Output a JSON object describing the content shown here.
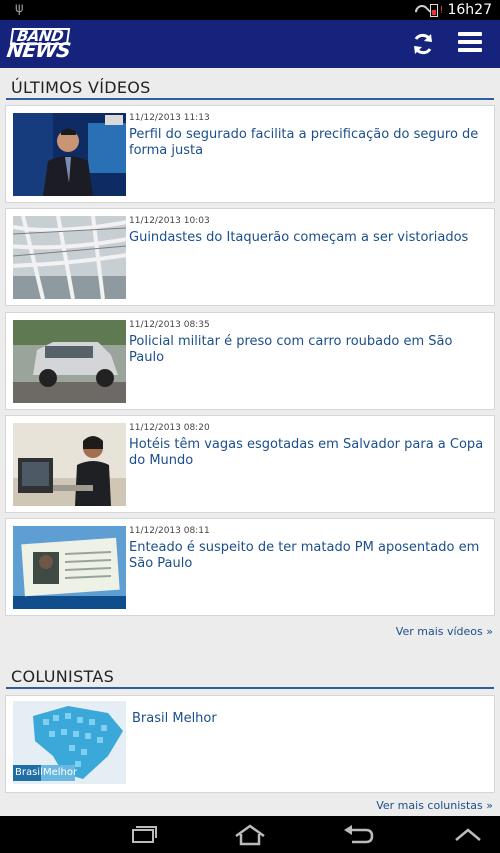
{
  "status": {
    "time": "16h27"
  },
  "app": {
    "logo_top": "BAND",
    "logo_bottom": "NEWS"
  },
  "videos": {
    "title": "ÚLTIMOS VÍDEOS",
    "more": "Ver mais vídeos »",
    "items": [
      {
        "date": "11/12/2013 11:13",
        "title": "Perfil do segurado facilita a precificação do seguro de forma justa"
      },
      {
        "date": "11/12/2013 10:03",
        "title": "Guindastes do Itaquerão começam a ser vistoriados"
      },
      {
        "date": "11/12/2013 08:35",
        "title": "Policial militar é preso com carro roubado em São Paulo"
      },
      {
        "date": "11/12/2013 08:20",
        "title": "Hotéis têm vagas esgotadas em Salvador para a Copa do Mundo"
      },
      {
        "date": "11/12/2013 08:11",
        "title": "Enteado é suspeito de ter matado PM aposentado em São Paulo"
      }
    ]
  },
  "columnists": {
    "title": "COLUNISTAS",
    "more": "Ver mais colunistas »",
    "items": [
      {
        "title": "Brasil Melhor",
        "thumb_text_a": "Brasil",
        "thumb_text_b": "Melhor"
      }
    ]
  },
  "icons": [
    "usb-icon",
    "wifi-icon",
    "battery-icon",
    "refresh-icon",
    "menu-icon",
    "recent-apps-icon",
    "home-icon",
    "back-icon",
    "up-icon"
  ],
  "colors": {
    "appbar": "#16237d",
    "link": "#1b4f8b",
    "rule": "#2f5f9a",
    "background": "#ececec"
  }
}
